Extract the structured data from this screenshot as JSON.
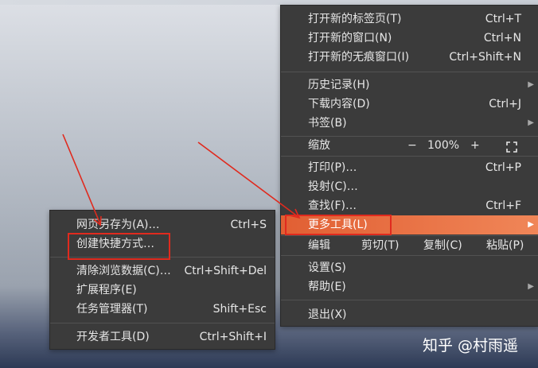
{
  "main_menu": {
    "new_tab": {
      "label": "打开新的标签页(T)",
      "shortcut": "Ctrl+T"
    },
    "new_window": {
      "label": "打开新的窗口(N)",
      "shortcut": "Ctrl+N"
    },
    "new_incognito": {
      "label": "打开新的无痕窗口(I)",
      "shortcut": "Ctrl+Shift+N"
    },
    "history": {
      "label": "历史记录(H)"
    },
    "downloads": {
      "label": "下载内容(D)",
      "shortcut": "Ctrl+J"
    },
    "bookmarks": {
      "label": "书签(B)"
    },
    "zoom": {
      "label": "缩放",
      "minus": "−",
      "value": "100%",
      "plus": "+"
    },
    "print": {
      "label": "打印(P)…",
      "shortcut": "Ctrl+P"
    },
    "cast": {
      "label": "投射(C)…"
    },
    "find": {
      "label": "查找(F)…",
      "shortcut": "Ctrl+F"
    },
    "more_tools": {
      "label": "更多工具(L)"
    },
    "edit": {
      "label": "编辑",
      "cut": "剪切(T)",
      "copy": "复制(C)",
      "paste": "粘贴(P)"
    },
    "settings": {
      "label": "设置(S)"
    },
    "help": {
      "label": "帮助(E)"
    },
    "exit": {
      "label": "退出(X)"
    }
  },
  "sub_menu": {
    "save_page": {
      "label": "网页另存为(A)…",
      "shortcut": "Ctrl+S"
    },
    "create_shortcut": {
      "label": "创建快捷方式…"
    },
    "clear_data": {
      "label": "清除浏览数据(C)…",
      "shortcut": "Ctrl+Shift+Del"
    },
    "extensions": {
      "label": "扩展程序(E)"
    },
    "task_manager": {
      "label": "任务管理器(T)",
      "shortcut": "Shift+Esc"
    },
    "dev_tools": {
      "label": "开发者工具(D)",
      "shortcut": "Ctrl+Shift+I"
    }
  },
  "watermark": "知乎 @村雨遥",
  "colors": {
    "highlight": "#ee7445",
    "annotation": "#e02a1e",
    "menu_bg": "#3b3b3b"
  },
  "icons": {
    "submenu_arrow": "chevron-right-icon",
    "fullscreen": "fullscreen-icon"
  }
}
